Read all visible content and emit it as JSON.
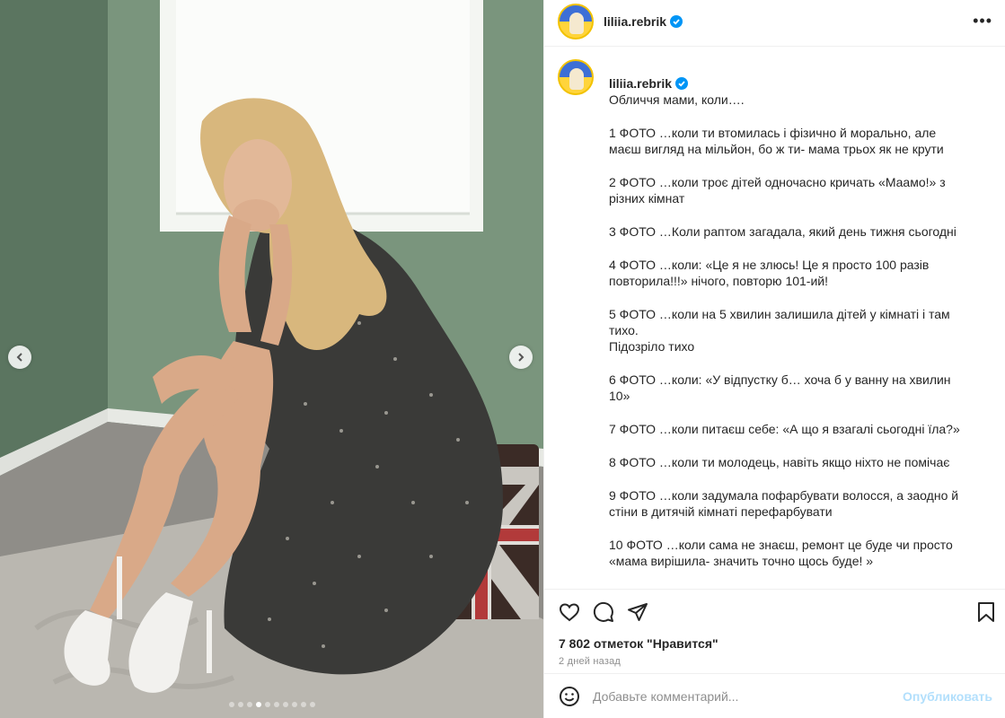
{
  "post": {
    "username": "liliia.rebrik",
    "more_icon": "more-horizontal-icon",
    "caption_intro": "Обличчя мами, коли….",
    "caption_lines": [
      "1 ФОТО …коли ти втомилась і фізично й морально, але маєш вигляд на мільйон, бо ж ти- мама трьох як не крути",
      "2 ФОТО …коли троє дітей одночасно кричать «Маамо!» з різних кімнат",
      "3 ФОТО …Коли раптом загадала, який день тижня сьогодні",
      "4 ФОТО …коли: «Це я не злюсь! Це я просто 100 разів повторила!!!» нічого, повторю 101-ий!",
      "5 ФОТО …коли на 5 хвилин залишила дітей у кімнаті і там тихо.\nПідозріло тихо",
      "6 ФОТО …коли: «У відпустку б… хоча б у ванну   на хвилин 10»",
      "7 ФОТО …коли питаєш себе: «А що я взагалі сьогодні їла?»",
      "8 ФОТО …коли ти молодець, навіть якщо ніхто не помічає",
      "9 ФОТО …коли задумала пофарбувати волосся, а заодно й стіни в дитячій кімнаті перефарбувати",
      "10 ФОТО …коли сама не знаєш, ремонт це буде чи просто «мама вирішила- значить точно щось буде!  »"
    ],
    "likes": "7 802 отметок \"Нравится\"",
    "time_ago": "2 дней назад",
    "comment_placeholder": "Добавьте комментарий...",
    "publish_label": "Опубликовать",
    "carousel": {
      "total": 10,
      "active": 4
    },
    "colors": {
      "accent": "#0095f6",
      "publish_disabled": "#b2dffc",
      "border": "#efefef"
    }
  }
}
